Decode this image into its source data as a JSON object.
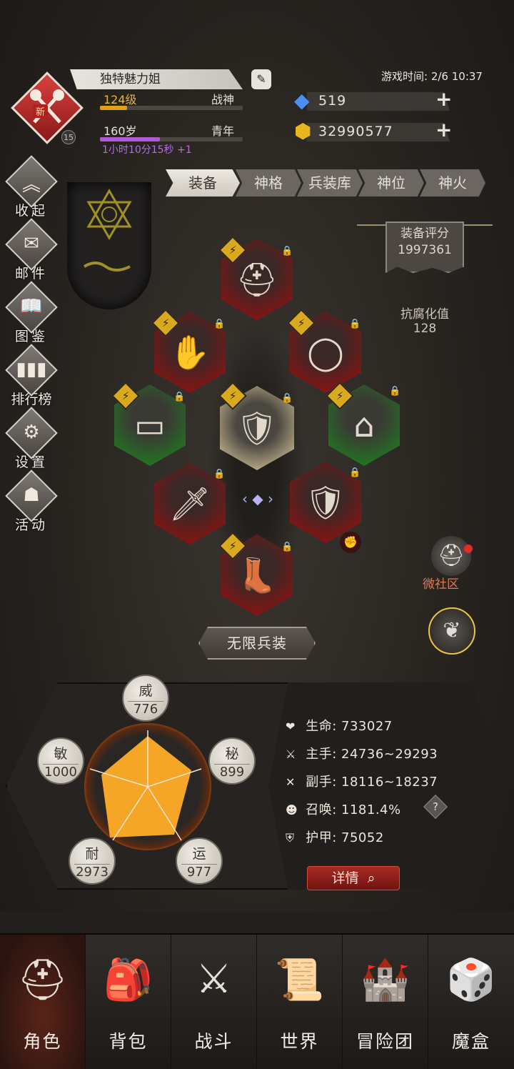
{
  "player": {
    "name": "独特魅力姐",
    "new_badge": "新",
    "avatar_level": "15",
    "level": "124级",
    "title": "战神",
    "age": "160岁",
    "age_stage": "青年",
    "timer": "1小时10分15秒 +1"
  },
  "game_time": "游戏时间: 2/6 10:37",
  "currency": {
    "gems": "519",
    "gold": "32990577"
  },
  "side_menu": [
    {
      "label": "收起",
      "icon": "collapse-icon"
    },
    {
      "label": "邮件",
      "icon": "mail-icon"
    },
    {
      "label": "图鉴",
      "icon": "book-icon"
    },
    {
      "label": "排行榜",
      "icon": "ranking-icon"
    },
    {
      "label": "设置",
      "icon": "gear-icon"
    },
    {
      "label": "活动",
      "icon": "event-icon"
    }
  ],
  "tabs": [
    "装备",
    "神格",
    "兵装库",
    "神位",
    "神火"
  ],
  "score": {
    "label": "装备评分",
    "value": "1997361"
  },
  "corruption": {
    "label": "抗腐化值",
    "value": "128"
  },
  "equipment": [
    {
      "slot": "helmet",
      "rarity": "red"
    },
    {
      "slot": "gauntlet",
      "rarity": "red"
    },
    {
      "slot": "ring",
      "rarity": "red"
    },
    {
      "slot": "belt",
      "rarity": "green"
    },
    {
      "slot": "armor",
      "rarity": "gold"
    },
    {
      "slot": "cloak",
      "rarity": "green"
    },
    {
      "slot": "weapon",
      "rarity": "red"
    },
    {
      "slot": "shield",
      "rarity": "red"
    },
    {
      "slot": "boots",
      "rarity": "red"
    }
  ],
  "unlimited_button": "无限兵装",
  "weishe_label": "微社区",
  "attributes": [
    {
      "name": "威",
      "value": "776"
    },
    {
      "name": "秘",
      "value": "899"
    },
    {
      "name": "运",
      "value": "977"
    },
    {
      "name": "耐",
      "value": "2973"
    },
    {
      "name": "敏",
      "value": "1000"
    }
  ],
  "stats": [
    {
      "text": "生命: 733027",
      "icon": "heart-icon"
    },
    {
      "text": "主手: 24736~29293",
      "icon": "sword-icon"
    },
    {
      "text": "副手: 18116~18237",
      "icon": "dagger-icon"
    },
    {
      "text": "召唤: 1181.4%",
      "icon": "summon-icon"
    },
    {
      "text": "护甲: 75052",
      "icon": "armor-icon"
    }
  ],
  "detail_button": "详情",
  "bottom_nav": [
    {
      "label": "角色",
      "icon": "helmet-icon"
    },
    {
      "label": "背包",
      "icon": "backpack-icon"
    },
    {
      "label": "战斗",
      "icon": "battle-icon"
    },
    {
      "label": "世界",
      "icon": "scroll-icon"
    },
    {
      "label": "冒险团",
      "icon": "castle-icon"
    },
    {
      "label": "魔盒",
      "icon": "magic-box-icon"
    }
  ],
  "colors": {
    "level_bar": "#e0a017",
    "age_bar": "#b15ad8",
    "accent_red": "#c41a1a",
    "accent_green": "#2fc32f",
    "accent_orange": "#e86a12"
  }
}
